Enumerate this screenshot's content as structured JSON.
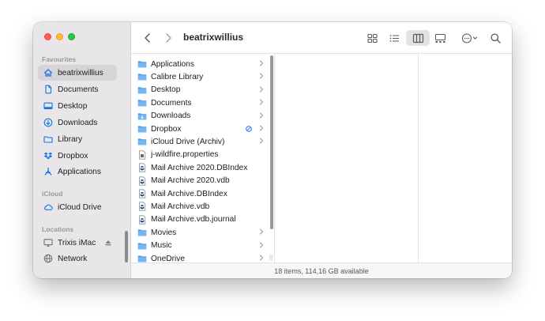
{
  "sidebar": {
    "favourites_title": "Favourites",
    "favourites": [
      {
        "label": "beatrixwillius",
        "icon": "home-icon",
        "selected": true
      },
      {
        "label": "Documents",
        "icon": "document-icon"
      },
      {
        "label": "Desktop",
        "icon": "desktop-icon"
      },
      {
        "label": "Downloads",
        "icon": "download-icon"
      },
      {
        "label": "Library",
        "icon": "folder-icon"
      },
      {
        "label": "Dropbox",
        "icon": "dropbox-icon"
      },
      {
        "label": "Applications",
        "icon": "applications-icon"
      }
    ],
    "icloud_title": "iCloud",
    "icloud": [
      {
        "label": "iCloud Drive",
        "icon": "cloud-icon"
      }
    ],
    "locations_title": "Locations",
    "locations": [
      {
        "label": "Trixis iMac",
        "icon": "imac-icon"
      },
      {
        "label": "Network",
        "icon": "network-icon"
      }
    ]
  },
  "toolbar": {
    "title": "beatrixwillius",
    "back_icon": "chevron-left-icon",
    "forward_icon": "chevron-right-icon",
    "view_icons": [
      "grid-view-icon",
      "list-view-icon",
      "column-view-icon",
      "gallery-view-icon"
    ],
    "more_icon": "ellipsis-circle-icon",
    "search_icon": "search-icon"
  },
  "files": [
    {
      "name": "Applications",
      "type": "folder",
      "chevron": true
    },
    {
      "name": "Calibre Library",
      "type": "folder",
      "chevron": true
    },
    {
      "name": "Desktop",
      "type": "folder",
      "chevron": true
    },
    {
      "name": "Documents",
      "type": "folder",
      "chevron": true
    },
    {
      "name": "Downloads",
      "type": "folder-download",
      "chevron": true
    },
    {
      "name": "Dropbox",
      "type": "folder",
      "chevron": true,
      "sync": true
    },
    {
      "name": "iCloud Drive (Archiv)",
      "type": "folder",
      "chevron": true
    },
    {
      "name": "j-wildfire.properties",
      "type": "file"
    },
    {
      "name": "Mail Archive 2020.DBIndex",
      "type": "db"
    },
    {
      "name": "Mail Archive 2020.vdb",
      "type": "db"
    },
    {
      "name": "Mail Archive.DBIndex",
      "type": "db"
    },
    {
      "name": "Mail Archive.vdb",
      "type": "db"
    },
    {
      "name": "Mail Archive.vdb.journal",
      "type": "db"
    },
    {
      "name": "Movies",
      "type": "folder",
      "chevron": true
    },
    {
      "name": "Music",
      "type": "folder",
      "chevron": true
    },
    {
      "name": "OneDrive",
      "type": "folder",
      "chevron": true
    }
  ],
  "status": {
    "text": "18 items, 114,16 GB available"
  },
  "colors": {
    "accent": "#1473e6",
    "folder": "#5aa9ea"
  }
}
